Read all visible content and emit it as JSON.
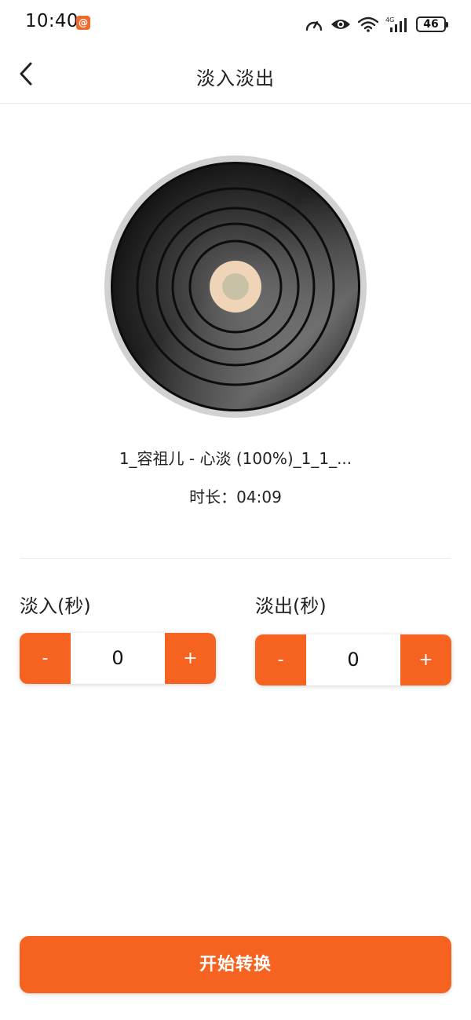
{
  "status_bar": {
    "time": "10:40",
    "app_badge_icon": "app-notification-icon",
    "icons": [
      "speedometer-icon",
      "eye-icon",
      "wifi-icon",
      "signal-4g-icon",
      "battery-icon"
    ],
    "network_label": "4G",
    "battery_level": "46"
  },
  "header": {
    "back_icon": "chevron-left-icon",
    "title": "淡入淡出"
  },
  "track": {
    "cover_icon": "vinyl-record-icon",
    "title": "1_容祖儿 - 心淡 (100%)_1_1_...",
    "duration": "时长：04:09"
  },
  "fade_in": {
    "label": "淡入(秒)",
    "minus_label": "-",
    "value": "0",
    "plus_label": "+"
  },
  "fade_out": {
    "label": "淡出(秒)",
    "minus_label": "-",
    "value": "0",
    "plus_label": "+"
  },
  "actions": {
    "start_label": "开始转换"
  },
  "colors": {
    "accent": "#f66321",
    "divider": "#ececec",
    "text": "#222222"
  }
}
